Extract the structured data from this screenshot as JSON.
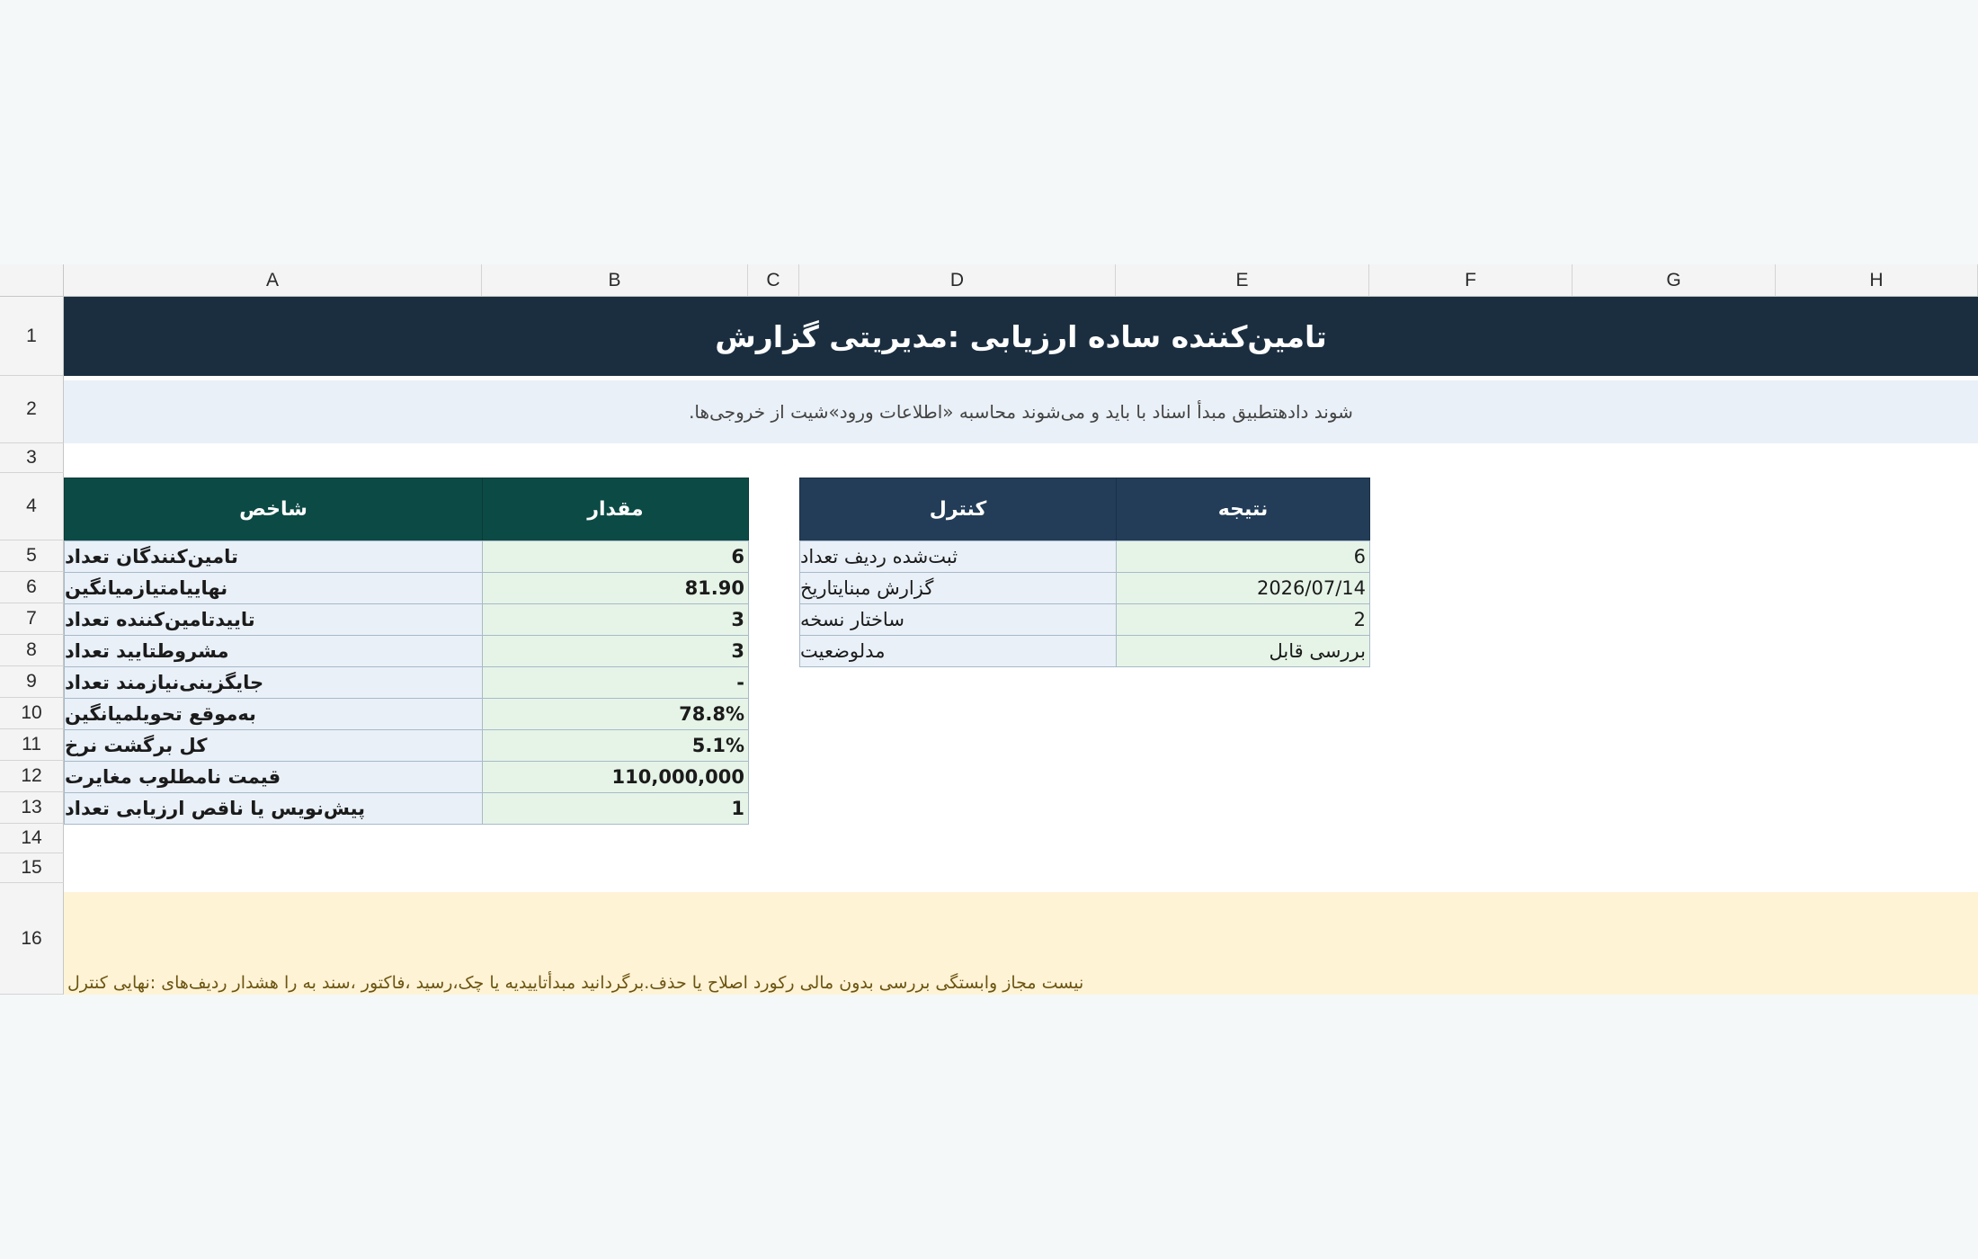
{
  "columns": [
    "A",
    "B",
    "C",
    "D",
    "E",
    "F",
    "G",
    "H"
  ],
  "rows": [
    "1",
    "2",
    "3",
    "4",
    "5",
    "6",
    "7",
    "8",
    "9",
    "10",
    "11",
    "12",
    "13",
    "14",
    "15",
    "16"
  ],
  "title": "تامین‌کننده ساده ارزیابی :مدیریتی گزارش",
  "subtitle": ".شوند دادهتطبیق مبدأ اسناد با باید و می‌شوند محاسبه «اطلاعات ورود»شیت از خروجی‌ها",
  "kpi_table": {
    "header_label": "شاخص",
    "header_value": "مقدار",
    "rows": [
      {
        "label": "تامین‌کنندگان تعداد",
        "value": "6"
      },
      {
        "label": "نهاییامتیازمیانگین",
        "value": "81.90"
      },
      {
        "label": "تاییدتامین‌کننده تعداد",
        "value": "3"
      },
      {
        "label": "مشروطتایید تعداد",
        "value": "3"
      },
      {
        "label": "جایگزینی‌نیازمند تعداد",
        "value": "-"
      },
      {
        "label": "به‌موقع تحویلمیانگین",
        "value": "78.8%"
      },
      {
        "label": "کل برگشت نرخ",
        "value": "5.1%"
      },
      {
        "label": "قیمت نامطلوب مغایرت",
        "value": "110,000,000"
      },
      {
        "label": "پیش‌نویس یا ناقص ارزیابی تعداد",
        "value": "1"
      }
    ]
  },
  "control_table": {
    "header_label": "کنترل",
    "header_value": "نتیجه",
    "rows": [
      {
        "label": "ثبت‌شده ردیف تعداد",
        "value": "6"
      },
      {
        "label": "گزارش مبنایتاریخ",
        "value": "2026/07/14"
      },
      {
        "label": "ساختار نسخه",
        "value": "2"
      },
      {
        "label": "مدلوضعیت",
        "value": "بررسی قابل"
      }
    ]
  },
  "footer_note": "نیست مجاز وابستگی بررسی بدون مالی رکورد اصلاح یا حذف.برگردانید مبدأتاییدیه یا چک،رسید ،فاکتور ،سند به را هشدار ردیف‌های :نهایی کنترل"
}
